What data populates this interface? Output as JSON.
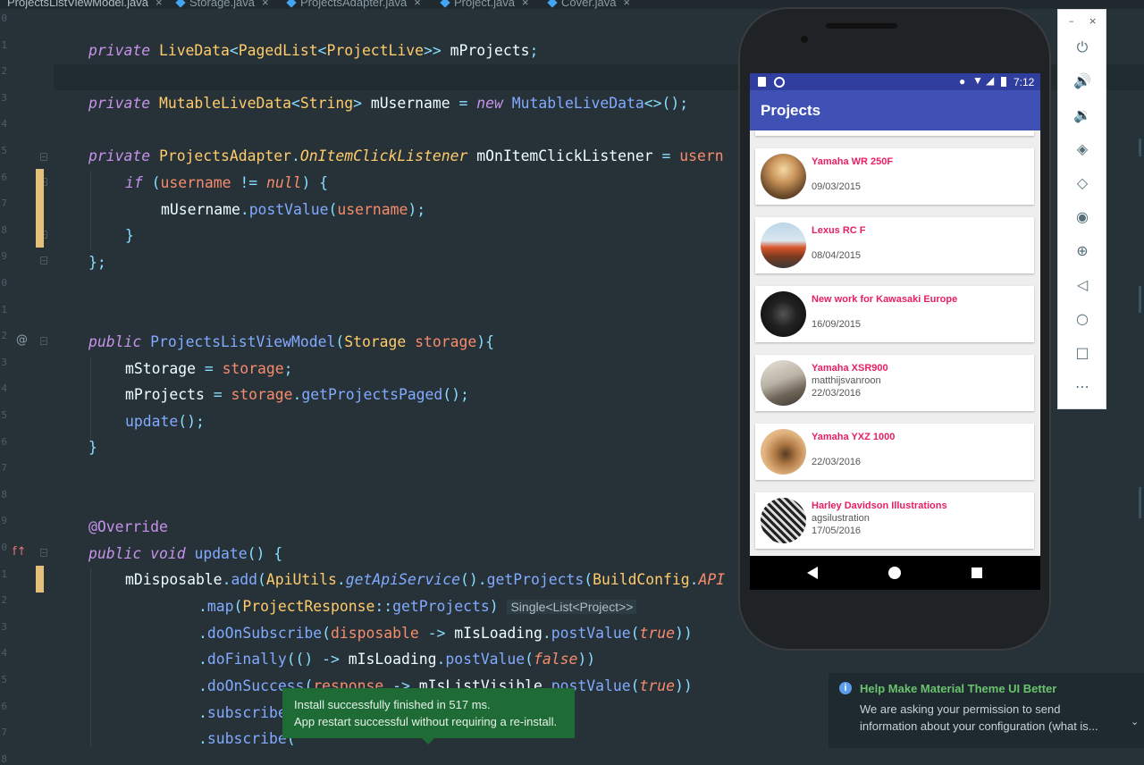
{
  "tabs": [
    {
      "label": "ProjectsListViewModel.java",
      "active": true
    },
    {
      "label": "Storage.java",
      "active": false
    },
    {
      "label": "ProjectsAdapter.java",
      "active": false
    },
    {
      "label": "Project.java",
      "active": false
    },
    {
      "label": "Cover.java",
      "active": false
    }
  ],
  "editor": {
    "line_numbers": [
      "0",
      "1",
      "2",
      "3",
      "4",
      "5",
      "6",
      "7",
      "8",
      "9",
      "0",
      "1",
      "2",
      "3",
      "4",
      "5",
      "6",
      "7",
      "8",
      "9",
      "0",
      "1",
      "2",
      "3",
      "4",
      "5",
      "6",
      "7",
      "8"
    ],
    "hint": "Single<List<Project>>",
    "gutter_at": "@",
    "gutter_fx": "f↑"
  },
  "emulator": {
    "time": "7:12",
    "app_title": "Projects",
    "projects": [
      {
        "title": "Yamaha WR 250F",
        "user": "",
        "date": "09/03/2015"
      },
      {
        "title": "Lexus RC F",
        "user": "",
        "date": "08/04/2015"
      },
      {
        "title": "New work for Kawasaki Europe",
        "user": "",
        "date": "16/09/2015"
      },
      {
        "title": "Yamaha XSR900",
        "user": "matthijsvanroon",
        "date": "22/03/2016"
      },
      {
        "title": "Yamaha YXZ 1000",
        "user": "",
        "date": "22/03/2016"
      },
      {
        "title": "Harley Davidson Illustrations",
        "user": "agsilustration",
        "date": "17/05/2016"
      }
    ],
    "toolbar_icons": [
      "power-icon",
      "volume-up-icon",
      "volume-down-icon",
      "rotate-left-icon",
      "rotate-right-icon",
      "camera-icon",
      "zoom-icon",
      "back-icon",
      "home-icon",
      "overview-icon",
      "more-icon"
    ],
    "window_minimize": "–",
    "window_close": "×"
  },
  "toast": {
    "line1": "Install successfully finished in 517 ms.",
    "line2": "App restart successful without requiring a re-install."
  },
  "notification": {
    "title": "Help Make Material Theme UI Better",
    "body1": "We are asking your permission to send",
    "body2": "information about your configuration (what is..."
  },
  "colors": {
    "editor_bg": "#263238",
    "keyword": "#c792ea",
    "type": "#ffcb6b",
    "function": "#82aaff",
    "accent_pink": "#e91e63",
    "appbar": "#3f51b5",
    "toast_bg": "#1e6b35"
  }
}
